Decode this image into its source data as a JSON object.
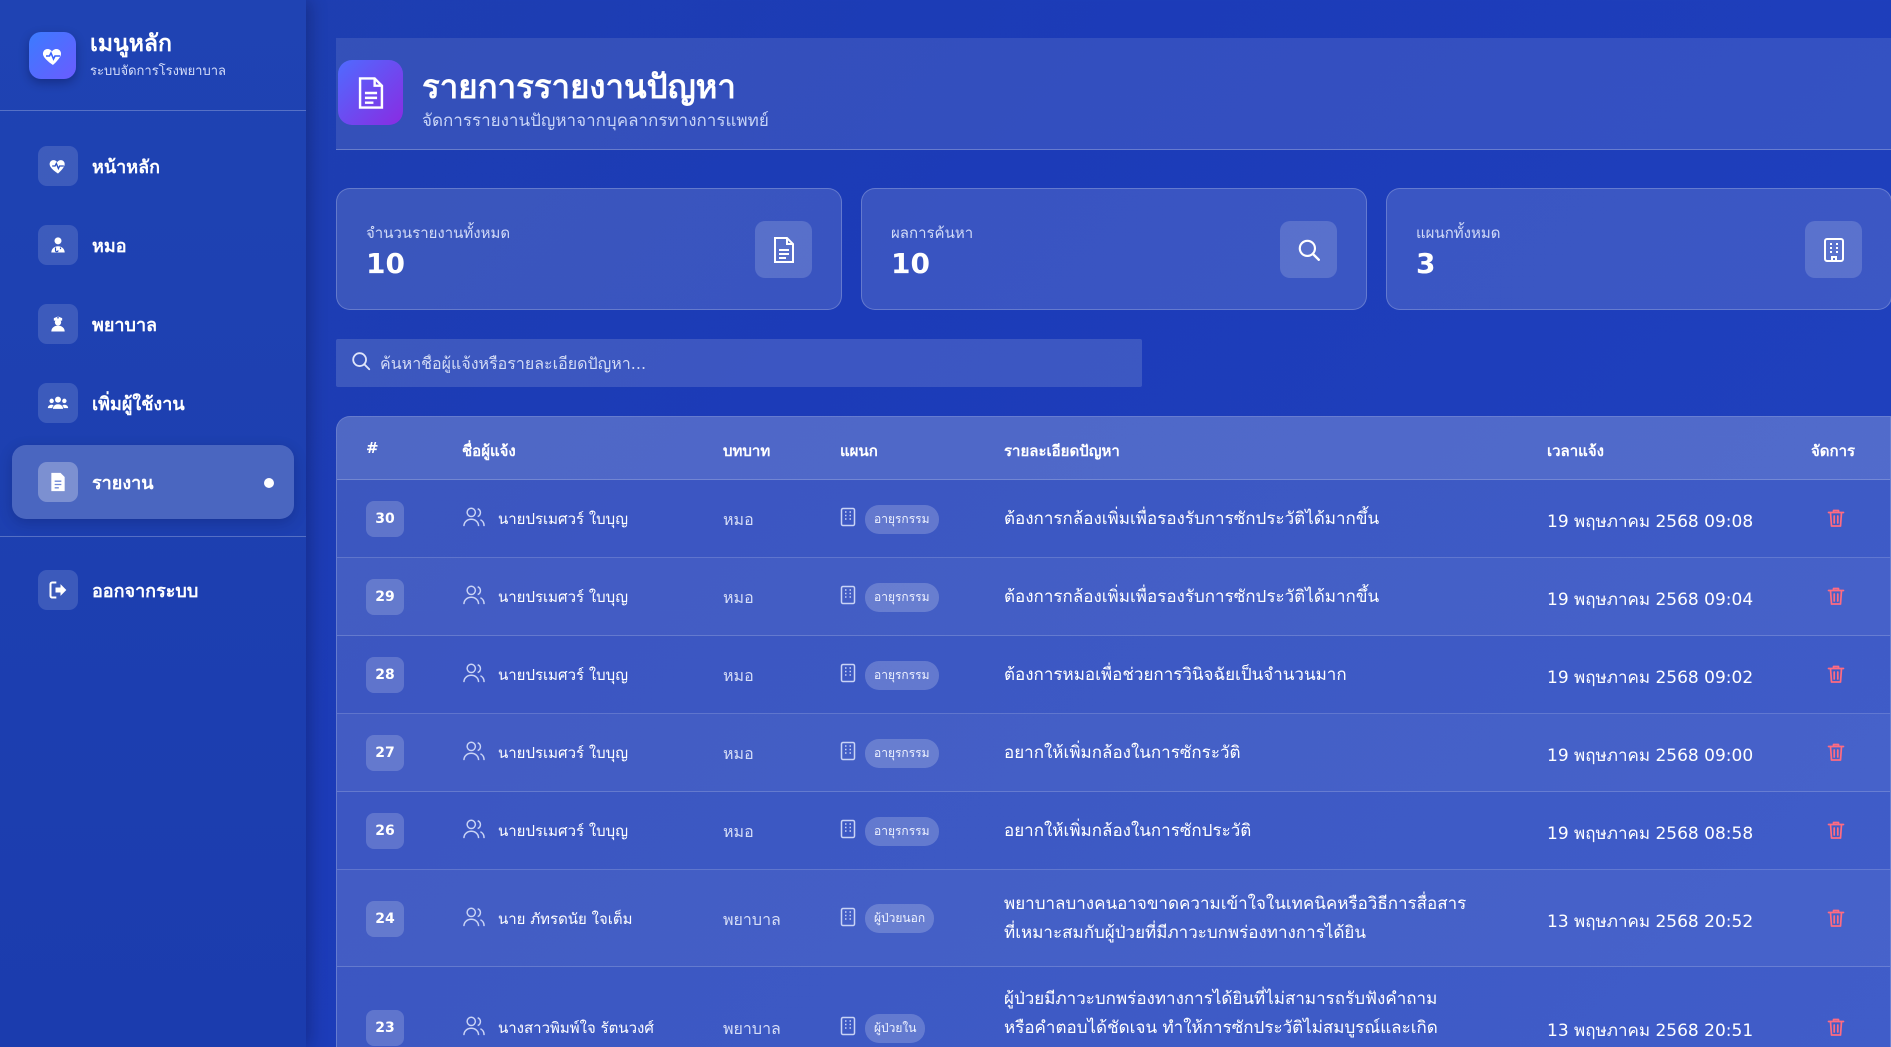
{
  "sidebar": {
    "title": "เมนูหลัก",
    "subtitle": "ระบบจัดการโรงพยาบาล",
    "items": [
      {
        "label": "หน้าหลัก",
        "icon": "heart-pulse-icon"
      },
      {
        "label": "หมอ",
        "icon": "doctor-icon"
      },
      {
        "label": "พยาบาล",
        "icon": "nurse-icon"
      },
      {
        "label": "เพิ่มผู้ใช้งาน",
        "icon": "users-icon"
      },
      {
        "label": "รายงาน",
        "icon": "document-icon",
        "active": true
      }
    ],
    "logout_label": "ออกจากระบบ"
  },
  "header": {
    "title": "รายการรายงานปัญหา",
    "subtitle": "จัดการรายงานปัญหาจากบุคลากรทางการแพทย์"
  },
  "stats": [
    {
      "label": "จำนวนรายงานทั้งหมด",
      "value": "10",
      "icon": "document-icon"
    },
    {
      "label": "ผลการค้นหา",
      "value": "10",
      "icon": "search-icon"
    },
    {
      "label": "แผนกทั้งหมด",
      "value": "3",
      "icon": "building-icon"
    }
  ],
  "search": {
    "placeholder": "ค้นหาชื่อผู้แจ้งหรือรายละเอียดปัญหา..."
  },
  "table": {
    "columns": [
      "#",
      "ชื่อผู้แจ้ง",
      "บทบาท",
      "แผนก",
      "รายละเอียดปัญหา",
      "เวลาแจ้ง",
      "จัดการ"
    ],
    "rows": [
      {
        "id": "30",
        "reporter": "นายปรเมศวร์ ใบบุญ",
        "role": "หมอ",
        "dept": "อายุรกรรม",
        "detail": [
          "ต้องการกล้องเพิ่มเพื่อรองรับการซักประวัติได้มากขึ้น"
        ],
        "time": "19 พฤษภาคม 2568 09:08"
      },
      {
        "id": "29",
        "reporter": "นายปรเมศวร์ ใบบุญ",
        "role": "หมอ",
        "dept": "อายุรกรรม",
        "detail": [
          "ต้องการกล้องเพิ่มเพื่อรองรับการซักประวัติได้มากขึ้น"
        ],
        "time": "19 พฤษภาคม 2568 09:04"
      },
      {
        "id": "28",
        "reporter": "นายปรเมศวร์ ใบบุญ",
        "role": "หมอ",
        "dept": "อายุรกรรม",
        "detail": [
          "ต้องการหมอเพื่อช่วยการวินิจฉัยเป็นจำนวนมาก"
        ],
        "time": "19 พฤษภาคม 2568 09:02"
      },
      {
        "id": "27",
        "reporter": "นายปรเมศวร์ ใบบุญ",
        "role": "หมอ",
        "dept": "อายุรกรรม",
        "detail": [
          "อยากให้เพิ่มกล้องในการซักระวัติ"
        ],
        "time": "19 พฤษภาคม 2568 09:00"
      },
      {
        "id": "26",
        "reporter": "นายปรเมศวร์ ใบบุญ",
        "role": "หมอ",
        "dept": "อายุรกรรม",
        "detail": [
          "อยากให้เพิ่มกล้องในการซักประวัติ"
        ],
        "time": "19 พฤษภาคม 2568 08:58"
      },
      {
        "id": "24",
        "reporter": "นาย ภัทรดนัย ใจเต็ม",
        "role": "พยาบาล",
        "dept": "ผู้ป่วยนอก",
        "detail": [
          "พยาบาลบางคนอาจขาดความเข้าใจในเทคนิคหรือวิธีการสื่อสาร",
          "ที่เหมาะสมกับผู้ป่วยที่มีภาวะบกพร่องทางการได้ยิน"
        ],
        "time": "13 พฤษภาคม 2568 20:52"
      },
      {
        "id": "23",
        "reporter": "นางสาวพิมพ์ใจ รัตนวงศ์",
        "role": "พยาบาล",
        "dept": "ผู้ป่วยใน",
        "detail": [
          "ผู้ป่วยมีภาวะบกพร่องทางการได้ยินที่ไม่สามารถรับฟังคำถาม",
          "หรือคำตอบได้ชัดเจน ทำให้การซักประวัติไม่สมบูรณ์และเกิด"
        ],
        "time": "13 พฤษภาคม 2568 20:51"
      }
    ]
  },
  "colors": {
    "accent": "#4f6bff",
    "delete": "#ff6b81"
  }
}
